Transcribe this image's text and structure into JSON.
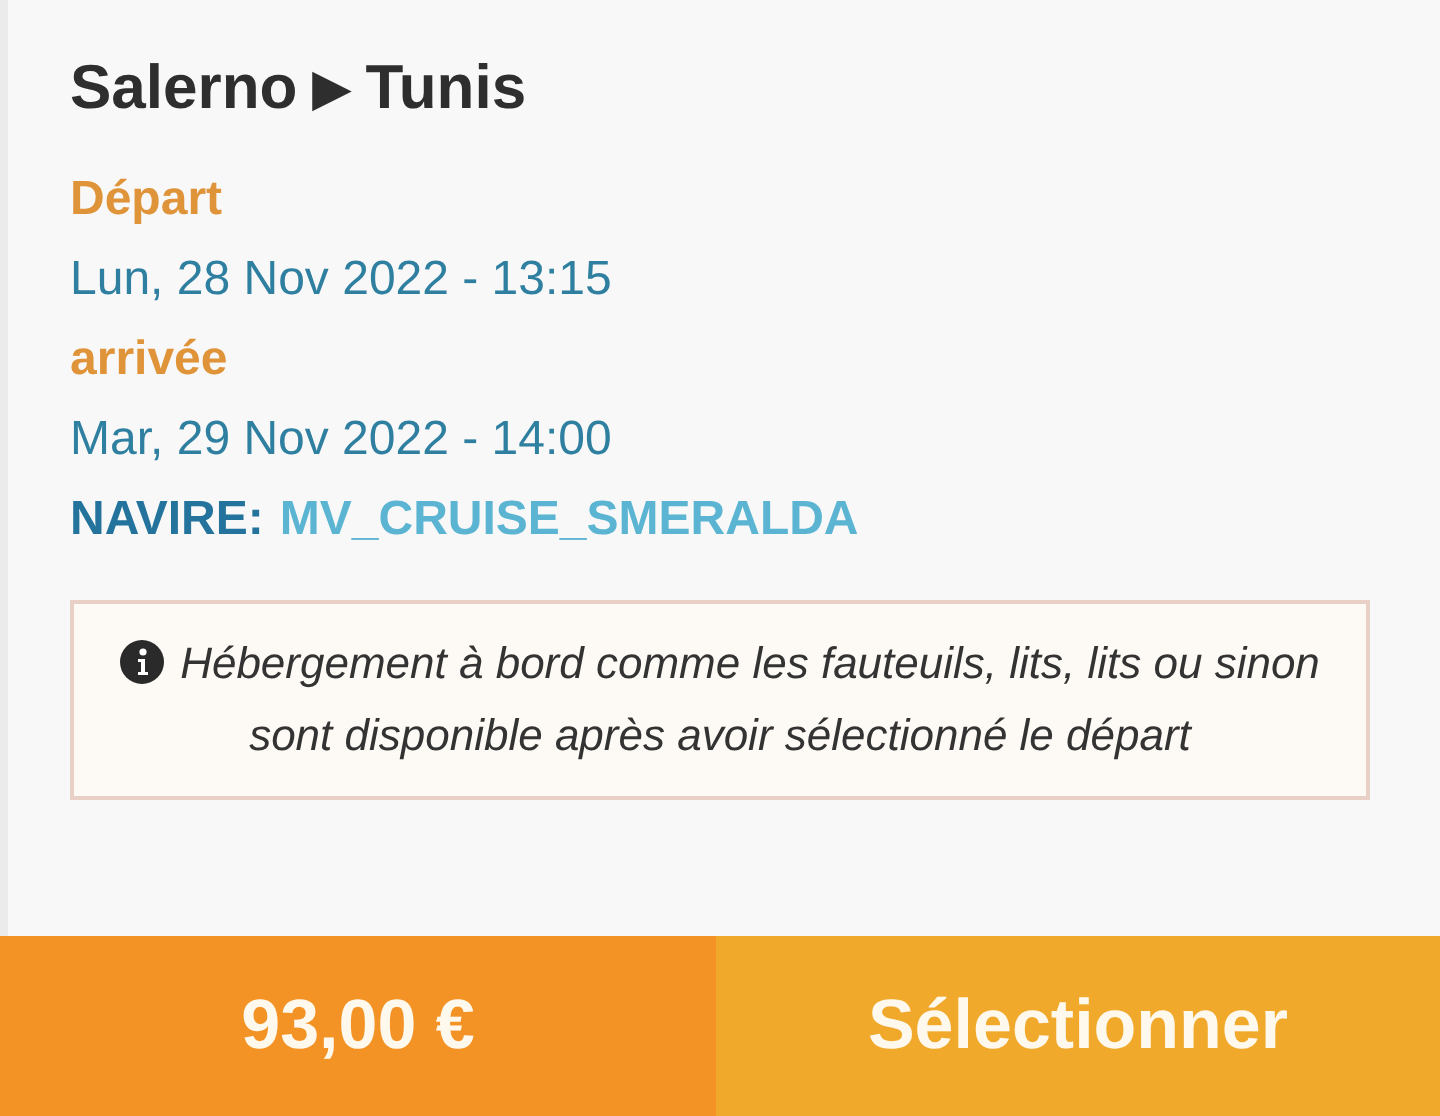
{
  "route": {
    "origin": "Salerno",
    "arrow": "▶",
    "destination": "Tunis"
  },
  "schedule": [
    {
      "kind": "label",
      "text": "Départ"
    },
    {
      "kind": "datetime",
      "text": "Lun, 28 Nov 2022 - 13:15"
    },
    {
      "kind": "label",
      "text": "arrivée"
    },
    {
      "kind": "datetime",
      "text": "Mar, 29 Nov 2022 - 14:00"
    }
  ],
  "vessel": {
    "label": "NAVIRE:",
    "name": "MV_CRUISE_SMERALDA"
  },
  "notice": "Hébergement à bord comme les fauteuils, lits, lits ou sinon sont disponible après avoir sélectionné le départ",
  "price": "93,00 €",
  "select_button": "Sélectionner"
}
